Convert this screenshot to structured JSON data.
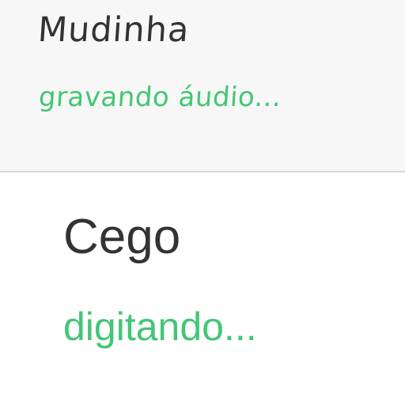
{
  "conversations": [
    {
      "contact_name": "Mudinha",
      "status": "gravando áudio..."
    },
    {
      "contact_name": "Cego",
      "status": "digitando..."
    }
  ],
  "colors": {
    "name_text": "#333333",
    "status_text": "#43c676",
    "top_panel_background": "#f7f7f7",
    "bottom_panel_background": "#ffffff",
    "divider": "#d7d7d7"
  }
}
